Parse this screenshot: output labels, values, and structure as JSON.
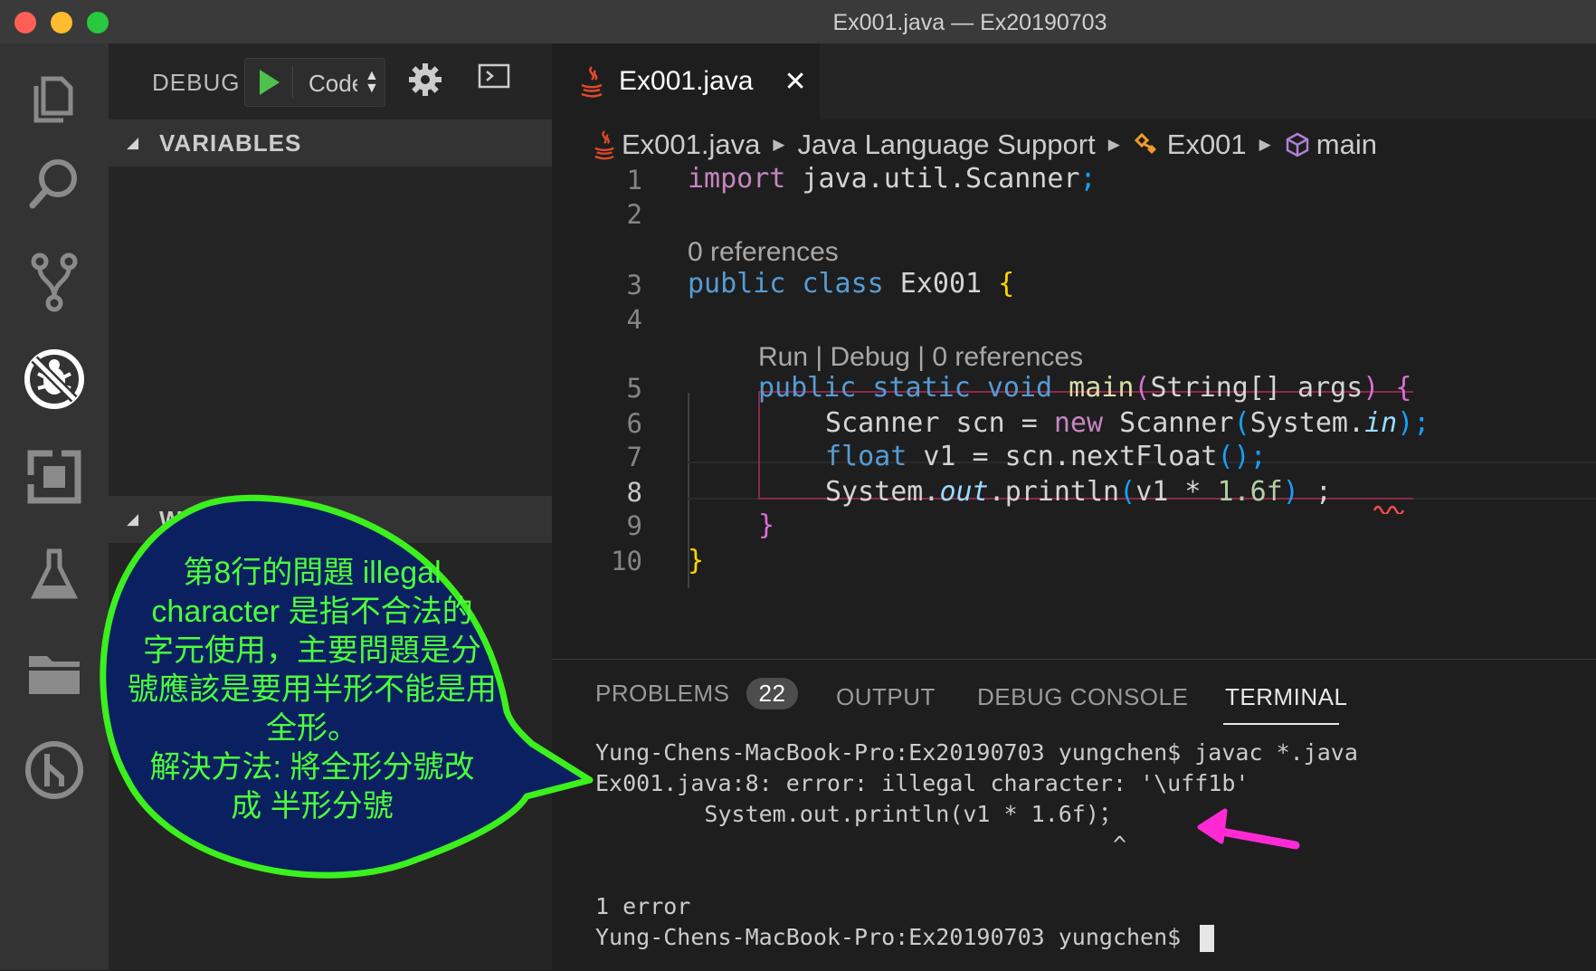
{
  "window": {
    "title": "Ex001.java — Ex20190703"
  },
  "activity_bar": {
    "items": [
      {
        "name": "explorer-icon"
      },
      {
        "name": "search-icon"
      },
      {
        "name": "source-control-icon"
      },
      {
        "name": "debug-icon",
        "active": true
      },
      {
        "name": "extensions-icon"
      },
      {
        "name": "test-icon"
      },
      {
        "name": "folder-icon"
      },
      {
        "name": "git-graph-icon"
      }
    ]
  },
  "debug_toolbar": {
    "label": "DEBUG",
    "config": "Code",
    "icons": [
      "play-icon",
      "gear-icon",
      "terminal-icon"
    ]
  },
  "sidebar": {
    "variables_title": "VARIABLES",
    "watch_title": "WATCH"
  },
  "tab": {
    "label": "Ex001.java",
    "close": "✕"
  },
  "breadcrumb": {
    "file": "Ex001.java",
    "section": "Java Language Support",
    "class": "Ex001",
    "method": "main"
  },
  "editor": {
    "lenses": {
      "class_refs": "0 references",
      "main_lens": "Run | Debug | 0 references"
    },
    "line_numbers": [
      "1",
      "2",
      "3",
      "4",
      "5",
      "6",
      "7",
      "8",
      "9",
      "10"
    ],
    "lines": {
      "l1_kw": "import",
      "l1_rest": " java.util.Scanner",
      "l1_semi": ";",
      "l3_kw1": "public",
      "l3_kw2": "class",
      "l3_name": " Ex001 ",
      "l3_brace": "{",
      "l5_kw": "public static void",
      "l5_fn": "main",
      "l5_paren_open": "(",
      "l5_params": "String[] args",
      "l5_paren_close": ")",
      "l5_brace": "{",
      "l6_a": "Scanner scn = ",
      "l6_new": "new",
      "l6_b": " Scanner",
      "l6_po": "(",
      "l6_c": "System.",
      "l6_in": "in",
      "l6_pc": ")",
      "l6_semi": ";",
      "l7_kw": "float",
      "l7_a": " v1 = scn.",
      "l7_fn": "nextFloat",
      "l7_p": "()",
      "l7_semi": ";",
      "l8_a": "System.",
      "l8_out": "out",
      "l8_b": ".",
      "l8_fn": "println",
      "l8_po": "(",
      "l8_c": "v1 * ",
      "l8_num": "1.6f",
      "l8_pc": ")",
      "l8_semi": " ;",
      "l9_brace": "}",
      "l10_brace": "}"
    }
  },
  "panel": {
    "tabs": [
      {
        "label": "PROBLEMS",
        "badge": "22"
      },
      {
        "label": "OUTPUT"
      },
      {
        "label": "DEBUG CONSOLE"
      },
      {
        "label": "TERMINAL",
        "active": true
      }
    ],
    "terminal_lines": [
      "Yung-Chens-MacBook-Pro:Ex20190703 yungchen$ javac *.java",
      "Ex001.java:8: error: illegal character: '\\uff1b'",
      "        System.out.println(v1 * 1.6f)；",
      "                                      ^",
      "",
      "1 error",
      "Yung-Chens-MacBook-Pro:Ex20190703 yungchen$ "
    ]
  },
  "annotation": {
    "text_lines": [
      "第8行的問題 illegal",
      "character 是指不合法的",
      "字元使用，主要問題是分",
      "號應該是要用半形不能是用",
      "全形。",
      "解決方法: 將全形分號改",
      "成 半形分號"
    ],
    "bubble_fill": "#0b2060",
    "bubble_stroke": "#3cf01e",
    "arrow_color": "#ff2ad4"
  }
}
